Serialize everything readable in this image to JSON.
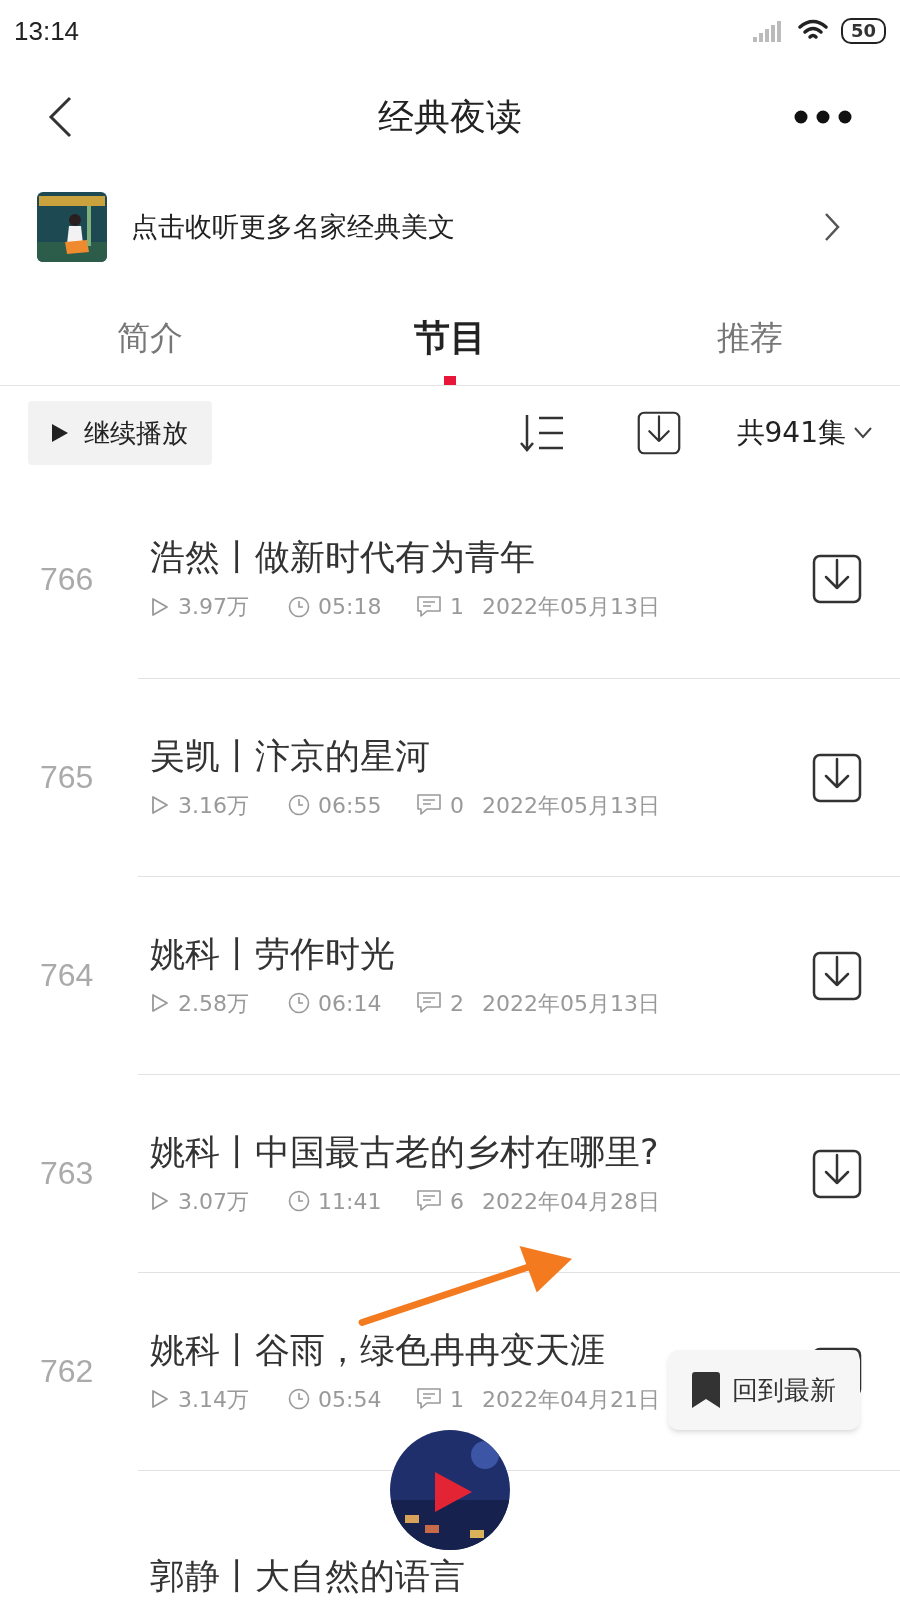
{
  "status_bar": {
    "time": "13:14",
    "battery": "50"
  },
  "header": {
    "title": "经典夜读"
  },
  "banner": {
    "text": "点击收听更多名家经典美文"
  },
  "tabs": [
    {
      "label": "简介",
      "selected": false
    },
    {
      "label": "节目",
      "selected": true
    },
    {
      "label": "推荐",
      "selected": false
    }
  ],
  "toolbar": {
    "continue_button": "继续播放",
    "episode_count": "共941集"
  },
  "episodes": [
    {
      "number": "766",
      "title": "浩然丨做新时代有为青年",
      "plays": "3.97万",
      "duration": "05:18",
      "comments": "1",
      "date": "2022年05月13日"
    },
    {
      "number": "765",
      "title": "吴凯丨汴京的星河",
      "plays": "3.16万",
      "duration": "06:55",
      "comments": "0",
      "date": "2022年05月13日"
    },
    {
      "number": "764",
      "title": "姚科丨劳作时光",
      "plays": "2.58万",
      "duration": "06:14",
      "comments": "2",
      "date": "2022年05月13日"
    },
    {
      "number": "763",
      "title": "姚科丨中国最古老的乡村在哪里?",
      "plays": "3.07万",
      "duration": "11:41",
      "comments": "6",
      "date": "2022年04月28日"
    },
    {
      "number": "762",
      "title": "姚科丨谷雨，绿色冉冉变天涯",
      "plays": "3.14万",
      "duration": "05:54",
      "comments": "1",
      "date": "2022年04月21日"
    },
    {
      "title": "郭静丨大自然的语言"
    }
  ],
  "back_to_latest": "回到最新"
}
